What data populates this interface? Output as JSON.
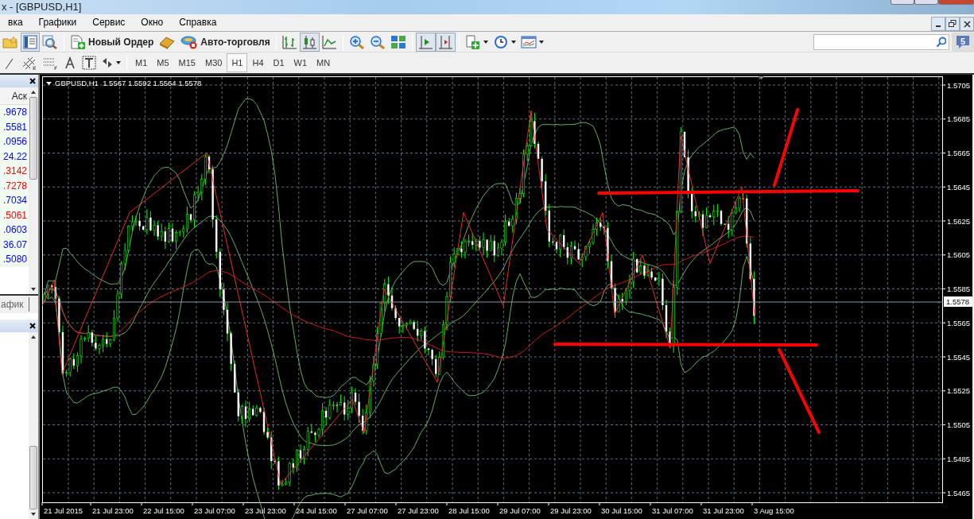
{
  "window": {
    "title": "x - [GBPUSD,H1]"
  },
  "menu": [
    "вка",
    "Графики",
    "Сервис",
    "Окно",
    "Справка"
  ],
  "toolbar": {
    "new_order": "Новый Ордер",
    "auto_trading": "Авто-торговля",
    "chart_modes": [
      {
        "selected": false
      },
      {
        "selected": true
      },
      {
        "selected": false
      }
    ],
    "scroll_buttons": [
      {
        "pressed": true
      },
      {
        "pressed": true
      }
    ]
  },
  "notifications": {
    "count": "5"
  },
  "timeframes": [
    {
      "label": "M1",
      "selected": false
    },
    {
      "label": "M5",
      "selected": false
    },
    {
      "label": "M15",
      "selected": false
    },
    {
      "label": "M30",
      "selected": false
    },
    {
      "label": "H1",
      "selected": true
    },
    {
      "label": "H4",
      "selected": false
    },
    {
      "label": "D1",
      "selected": false
    },
    {
      "label": "W1",
      "selected": false
    },
    {
      "label": "MN",
      "selected": false
    }
  ],
  "market_watch": {
    "column": "Аск",
    "quotes": [
      {
        "value": ".9678",
        "color": "#0000ff"
      },
      {
        "value": ".5581",
        "color": "#0000ff"
      },
      {
        "value": ".0956",
        "color": "#0000ff"
      },
      {
        "value": "24.22",
        "color": "#0000ff"
      },
      {
        "value": ".3142",
        "color": "#ff0000"
      },
      {
        "value": ".7278",
        "color": "#ff0000"
      },
      {
        "value": ".7034",
        "color": "#0000ff"
      },
      {
        "value": ".5061",
        "color": "#ff0000"
      },
      {
        "value": ".0603",
        "color": "#0000ff"
      },
      {
        "value": "36.07",
        "color": "#0000ff"
      },
      {
        "value": ".5080",
        "color": "#0000ff"
      }
    ],
    "tab": "афик"
  },
  "chart": {
    "header": "GBPUSD,H1  1.5567 1.5592 1.5564 1.5578",
    "price_labels": [
      "1.5705",
      "1.5685",
      "1.5665",
      "1.5645",
      "1.5625",
      "1.5605",
      "1.5585",
      "1.5565",
      "1.5545",
      "1.5525",
      "1.5505",
      "1.5485",
      "1.5465"
    ],
    "current_price": "1.5578",
    "time_labels": [
      "21 Jul 2015",
      "21 Jul 23:00",
      "22 Jul 15:00",
      "23 Jul 07:00",
      "23 Jul 23:00",
      "24 Jul 15:00",
      "27 Jul 07:00",
      "27 Jul 23:00",
      "28 Jul 15:00",
      "29 Jul 07:00",
      "29 Jul 23:00",
      "30 Jul 15:00",
      "31 Jul 07:00",
      "31 Jul 23:00",
      "3 Aug 15:00"
    ]
  }
}
